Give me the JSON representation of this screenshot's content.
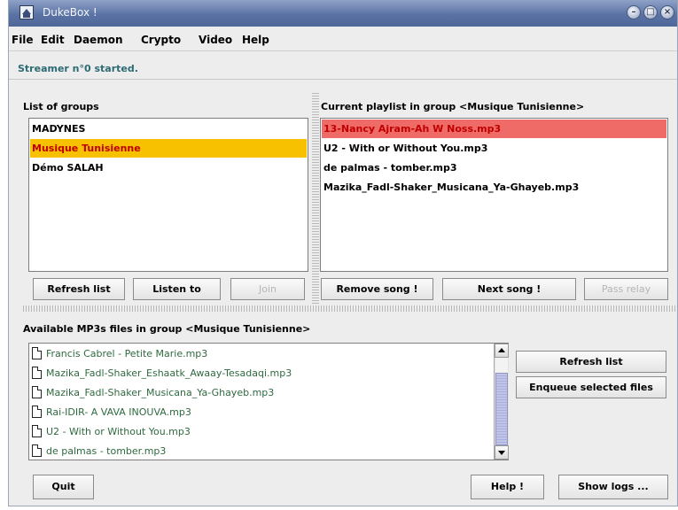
{
  "window": {
    "title": "DukeBox !"
  },
  "menu": [
    "File",
    "Edit",
    "Daemon",
    "Crypto",
    "Video",
    "Help"
  ],
  "status": "Streamer n°0 started.",
  "groups": {
    "label": "List of groups",
    "items": [
      "MADYNES",
      "Musique Tunisienne",
      "Démo SALAH"
    ],
    "selected_index": 1,
    "buttons": {
      "refresh": "Refresh list",
      "listen": "Listen to",
      "join": "Join"
    }
  },
  "playlist": {
    "label": "Current playlist in group <Musique Tunisienne>",
    "items": [
      "13-Nancy Ajram-Ah W Noss.mp3",
      "U2 - With or Without You.mp3",
      "de palmas - tomber.mp3",
      "Mazika_Fadl-Shaker_Musicana_Ya-Ghayeb.mp3"
    ],
    "playing_index": 0,
    "buttons": {
      "remove": "Remove song !",
      "next": "Next song !",
      "relay": "Pass relay"
    }
  },
  "files": {
    "label": "Available MP3s files in group <Musique Tunisienne>",
    "items": [
      "Francis Cabrel - Petite Marie.mp3",
      "Mazika_Fadl-Shaker_Eshaatk_Awaay-Tesadaqi.mp3",
      "Mazika_Fadl-Shaker_Musicana_Ya-Ghayeb.mp3",
      "Rai-IDIR- A VAVA INOUVA.mp3",
      "U2 - With or Without You.mp3",
      "de palmas - tomber.mp3"
    ],
    "buttons": {
      "refresh": "Refresh list",
      "enqueue": "Enqueue selected files"
    }
  },
  "footer": {
    "quit": "Quit",
    "help": "Help !",
    "logs": "Show logs ..."
  },
  "colors": {
    "group_selected_bg": "#f8c100",
    "playing_bg": "#ee6b68",
    "selected_text": "#c00000",
    "file_text": "#2f6a3f",
    "status_text": "#2c6b74"
  }
}
